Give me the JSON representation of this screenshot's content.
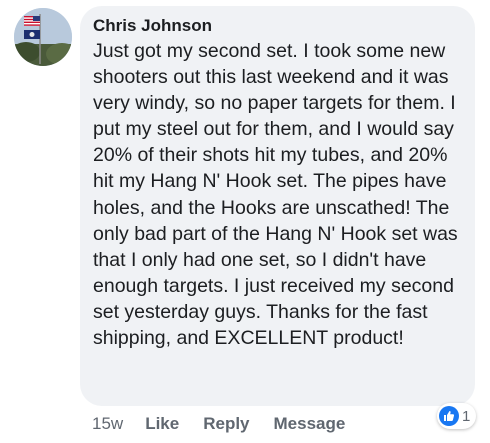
{
  "comment": {
    "author": "Chris Johnson",
    "text": "Just got my second set. I took some new shooters out this last weekend and it was very windy, so no paper targets for them. I put my steel out for them, and I would say 20% of their shots hit my tubes, and 20% hit my Hang N' Hook set. The pipes have holes, and the Hooks are unscathed! The only bad part of the Hang N' Hook set was that I only had one set, so I didn't have enough targets. I just received my second set yesterday guys. Thanks for the fast shipping, and EXCELLENT product!",
    "timestamp": "15w",
    "actions": {
      "like": "Like",
      "reply": "Reply",
      "message": "Message"
    },
    "reactions": {
      "icon": "thumbs-up-icon",
      "count": "1",
      "color": "#1877f2"
    }
  },
  "colors": {
    "bubble": "#f0f2f5",
    "text": "#1c1e21",
    "secondary": "#606770",
    "accent": "#1877f2"
  }
}
